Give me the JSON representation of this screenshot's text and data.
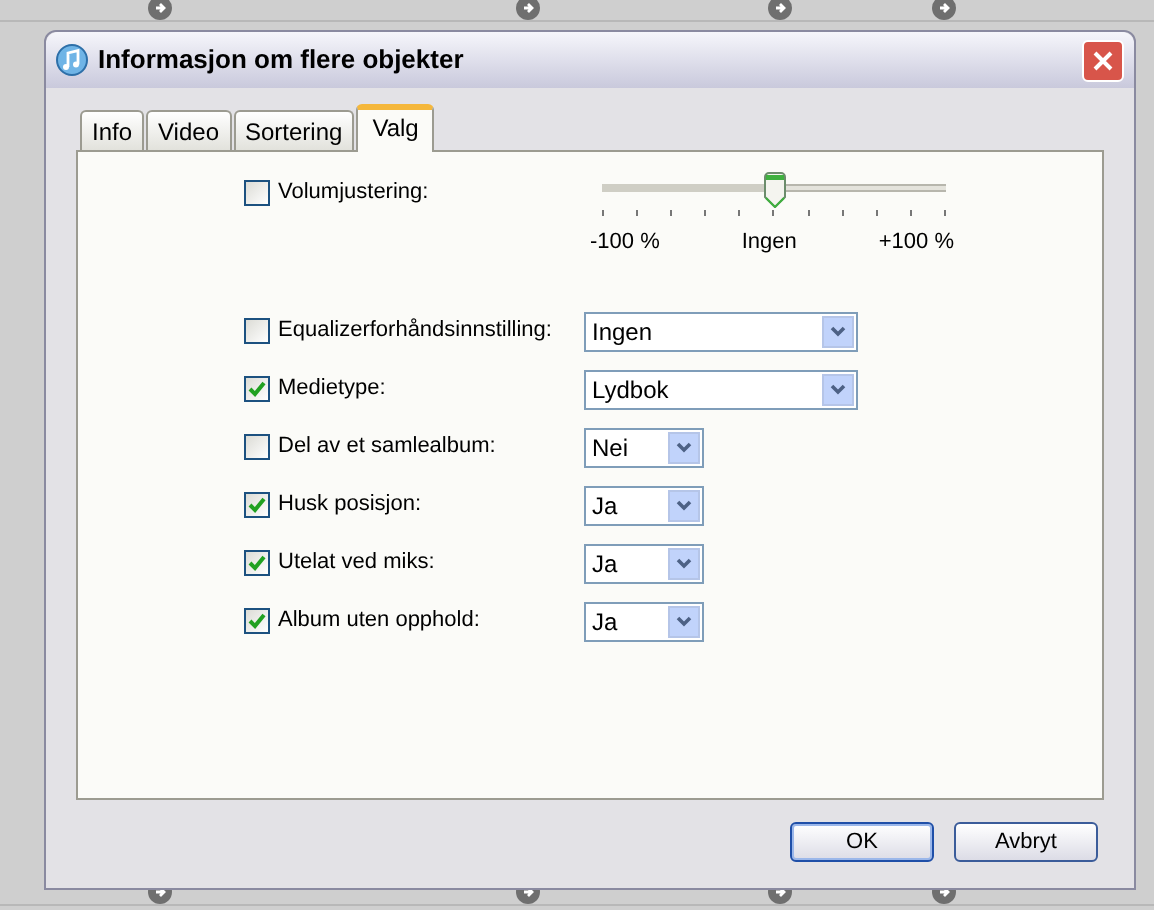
{
  "window": {
    "title": "Informasjon om flere objekter"
  },
  "tabs": [
    {
      "label": "Info",
      "selected": false
    },
    {
      "label": "Video",
      "selected": false
    },
    {
      "label": "Sortering",
      "selected": false
    },
    {
      "label": "Valg",
      "selected": true
    }
  ],
  "options": [
    {
      "kind": "slider",
      "label": "Volumjustering:",
      "checked": false,
      "level": 0.5,
      "min_label": "-100 %",
      "mid_label": "Ingen",
      "max_label": "+100 %"
    },
    {
      "kind": "select",
      "label": "Equalizerforhåndsinnstilling:",
      "checked": false,
      "value": "Ingen",
      "wide": true
    },
    {
      "kind": "select",
      "label": "Medietype:",
      "checked": true,
      "value": "Lydbok",
      "wide": true
    },
    {
      "kind": "select",
      "label": "Del av et samlealbum:",
      "checked": false,
      "value": "Nei",
      "wide": false
    },
    {
      "kind": "select",
      "label": "Husk posisjon:",
      "checked": true,
      "value": "Ja",
      "wide": false
    },
    {
      "kind": "select",
      "label": "Utelat ved miks:",
      "checked": true,
      "value": "Ja",
      "wide": false
    },
    {
      "kind": "select",
      "label": "Album uten opphold:",
      "checked": true,
      "value": "Ja",
      "wide": false
    }
  ],
  "buttons": [
    {
      "label": "OK",
      "default": true
    },
    {
      "label": "Avbryt",
      "default": false
    }
  ]
}
